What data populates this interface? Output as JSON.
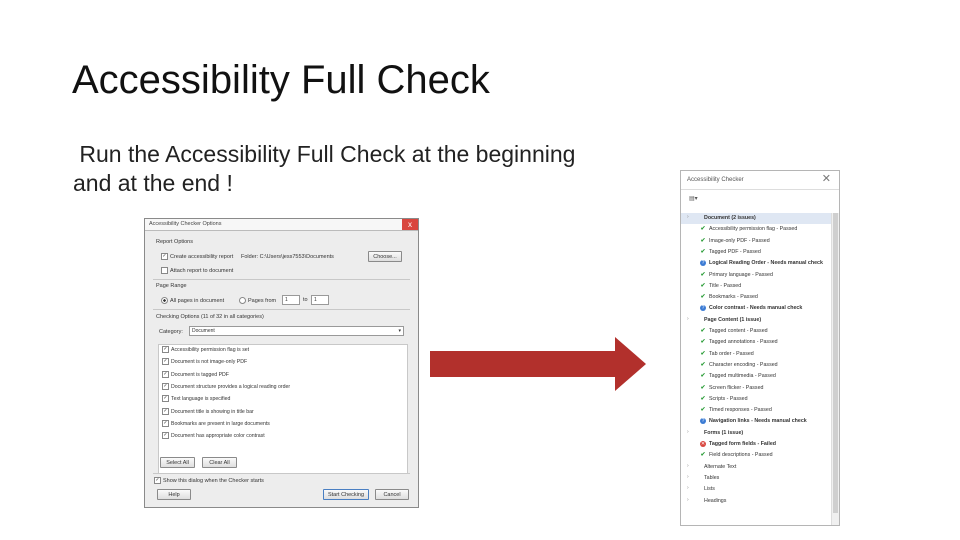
{
  "slide": {
    "title": "Accessibility Full Check",
    "subtitle": " Run the Accessibility Full Check at the beginning\nand at the end !"
  },
  "dialog": {
    "title": "Accessibility Checker Options",
    "report_options": "Report Options",
    "create_report": "Create accessibility report",
    "folder_label": "Folder: C:\\Users\\jess7553\\Documents",
    "choose_button": "Choose...",
    "attach_report": "Attach report to document",
    "page_range": "Page Range",
    "all_pages": "All pages in document",
    "pages_from": "Pages from",
    "from_value": "1",
    "to_label": "to",
    "to_value": "1",
    "checking_options": "Checking Options (11 of 32 in all categories)",
    "category_label": "Category:",
    "category_value": "Document",
    "checks": [
      "Accessibility permission flag is set",
      "Document is not image-only PDF",
      "Document is tagged PDF",
      "Document structure provides a logical reading order",
      "Text language is specified",
      "Document title is showing in title bar",
      "Bookmarks are present in large documents",
      "Document has appropriate color contrast"
    ],
    "select_all": "Select All",
    "clear_all": "Clear All",
    "show_dialog": "Show this dialog when the Checker starts",
    "help": "Help",
    "start_checking": "Start Checking",
    "cancel": "Cancel",
    "close_glyph": "x"
  },
  "arrow": {
    "color": "#b2302c"
  },
  "panel": {
    "title": "Accessibility Checker",
    "close_glyph": "✕",
    "toolbar_glyph": "▤▾",
    "tree": [
      {
        "type": "group",
        "label": "Document (2 issues)",
        "hl": true
      },
      {
        "type": "item",
        "status": "pass",
        "label": "Accessibility permission flag - Passed"
      },
      {
        "type": "item",
        "status": "pass",
        "label": "Image-only PDF - Passed"
      },
      {
        "type": "item",
        "status": "pass",
        "label": "Tagged PDF - Passed"
      },
      {
        "type": "item",
        "status": "manual",
        "label": "Logical Reading Order - Needs manual check"
      },
      {
        "type": "item",
        "status": "pass",
        "label": "Primary language - Passed"
      },
      {
        "type": "item",
        "status": "pass",
        "label": "Title - Passed"
      },
      {
        "type": "item",
        "status": "pass",
        "label": "Bookmarks - Passed"
      },
      {
        "type": "item",
        "status": "manual",
        "label": "Color contrast - Needs manual check"
      },
      {
        "type": "group",
        "label": "Page Content (1 issue)"
      },
      {
        "type": "item",
        "status": "pass",
        "label": "Tagged content - Passed"
      },
      {
        "type": "item",
        "status": "pass",
        "label": "Tagged annotations - Passed"
      },
      {
        "type": "item",
        "status": "pass",
        "label": "Tab order - Passed"
      },
      {
        "type": "item",
        "status": "pass",
        "label": "Character encoding - Passed"
      },
      {
        "type": "item",
        "status": "pass",
        "label": "Tagged multimedia - Passed"
      },
      {
        "type": "item",
        "status": "pass",
        "label": "Screen flicker - Passed"
      },
      {
        "type": "item",
        "status": "pass",
        "label": "Scripts - Passed"
      },
      {
        "type": "item",
        "status": "pass",
        "label": "Timed responses - Passed"
      },
      {
        "type": "item",
        "status": "manual",
        "label": "Navigation links - Needs manual check"
      },
      {
        "type": "group",
        "label": "Forms (1 issue)"
      },
      {
        "type": "item",
        "status": "fail",
        "label": "Tagged form fields - Failed"
      },
      {
        "type": "item",
        "status": "pass",
        "label": "Field descriptions - Passed"
      },
      {
        "type": "group2",
        "label": "Alternate Text"
      },
      {
        "type": "group2",
        "label": "Tables"
      },
      {
        "type": "group2",
        "label": "Lists"
      },
      {
        "type": "group2",
        "label": "Headings"
      }
    ]
  }
}
